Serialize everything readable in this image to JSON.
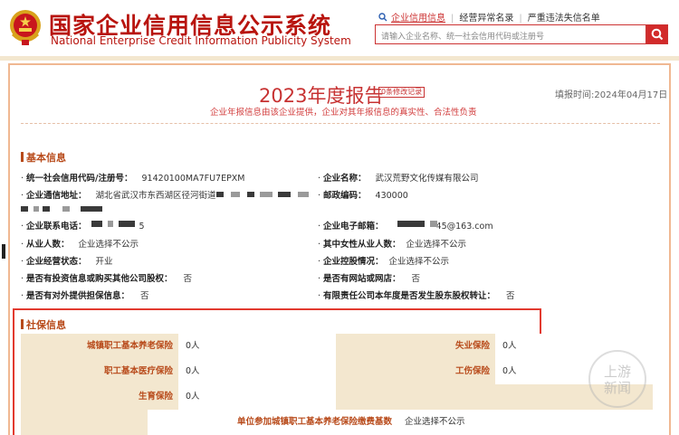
{
  "header": {
    "title_cn": "国家企业信用信息公示系统",
    "title_en": "National Enterprise Credit Information Publicity System",
    "nav": [
      "企业信用信息",
      "经营异常名录",
      "严重违法失信名单"
    ],
    "search_placeholder": "请输入企业名称、统一社会信用代码或注册号",
    "search_icon": "search-icon"
  },
  "report": {
    "title": "2023年度报告",
    "mod_badge": "0条修改记录",
    "fill_time": "填报时间:2024年04月17日",
    "subtitle": "企业年报信息由该企业提供，企业对其年报信息的真实性、合法性负责"
  },
  "basic": {
    "heading": "基本信息",
    "credit_code_label": "统一社会信用代码/注册号：",
    "credit_code": "91420100MA7FU7EPXM",
    "name_label": "企业名称：",
    "name": "武汉荒野文化传媒有限公司",
    "address_label": "企业通信地址：",
    "address": "湖北省武汉市东西湖区径河街道",
    "postcode_label": "邮政编码：",
    "postcode": "430000",
    "phone_label": "企业联系电话：",
    "phone_tail": "5",
    "email_label": "企业电子邮箱：",
    "email_tail": "45@163.com",
    "employees_label": "从业人数：",
    "employees": "企业选择不公示",
    "female_label": "其中女性从业人数：",
    "female": "企业选择不公示",
    "status_label": "企业经营状态：",
    "status": "开业",
    "control_label": "企业控股情况：",
    "control": "企业选择不公示",
    "invest_label": "是否有投资信息或购买其他公司股权：",
    "invest": "否",
    "website_label": "是否有网站或网店：",
    "website": "否",
    "guarantee_label": "是否有对外提供担保信息：",
    "guarantee": "否",
    "transfer_label": "有限责任公司本年度是否发生股东股权转让：",
    "transfer": "否"
  },
  "social": {
    "heading": "社保信息",
    "pension_label": "城镇职工基本养老保险",
    "pension": "0人",
    "unemployment_label": "失业保险",
    "unemployment": "0人",
    "medical_label": "职工基本医疗保险",
    "medical": "0人",
    "injury_label": "工伤保险",
    "injury": "0人",
    "maternity_label": "生育保险",
    "maternity": "0人",
    "base_label": "单位参加城镇职工基本养老保险缴费基数",
    "base": "企业选择不公示"
  },
  "watermark": [
    "上游",
    "新闻"
  ],
  "colors": {
    "brand_red": "#b8140e",
    "accent_orange": "#b84a1a",
    "highlight_red": "#e23a2f",
    "label_bg": "#f3e7cf"
  }
}
